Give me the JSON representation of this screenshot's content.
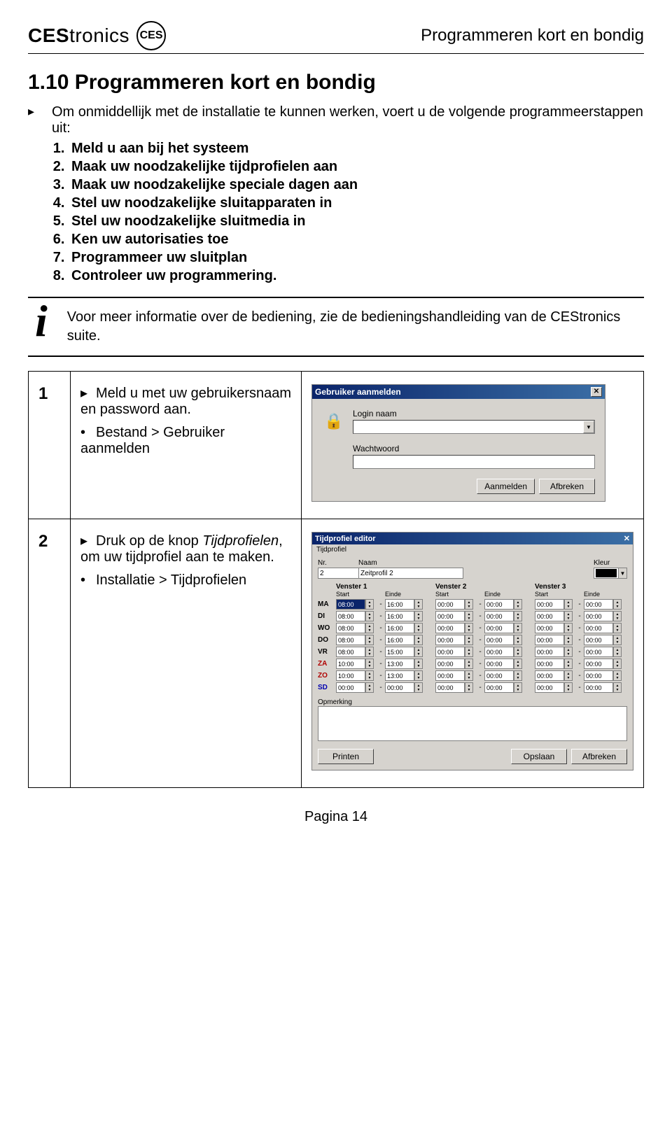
{
  "header": {
    "brand_prefix": "CES",
    "brand_suffix": "tronics",
    "badge": "CES",
    "doc_title": "Programmeren kort en bondig"
  },
  "section": {
    "title": "1.10 Programmeren kort en bondig",
    "intro": "Om onmiddellijk met de installatie te kunnen werken, voert u de volgende programmeerstappen uit:",
    "steps": [
      "Meld u aan bij het systeem",
      "Maak uw noodzakelijke tijdprofielen aan",
      "Maak uw noodzakelijke speciale dagen aan",
      "Stel uw noodzakelijke sluitapparaten in",
      "Stel uw noodzakelijke sluitmedia in",
      "Ken uw autorisaties toe",
      "Programmeer uw sluitplan",
      "Controleer uw programmering."
    ],
    "info": "Voor meer informatie over de bediening, zie de bedieningshandleiding van de CEStronics suite."
  },
  "table": {
    "row1": {
      "num": "1",
      "main": "Meld u met uw gebruikersnaam en password aan.",
      "sub": "Bestand > Gebruiker aanmelden"
    },
    "row2": {
      "num": "2",
      "main_a": "Druk op de knop ",
      "main_em": "Tijdprofielen",
      "main_b": ", om uw tijdprofiel aan te maken.",
      "sub": "Installatie > Tijdprofielen"
    }
  },
  "dlg1": {
    "title": "Gebruiker aanmelden",
    "label_login": "Login naam",
    "label_pass": "Wachtwoord",
    "btn_ok": "Aanmelden",
    "btn_cancel": "Afbreken"
  },
  "dlg2": {
    "title": "Tijdprofiel editor",
    "menu": "Tijdprofiel",
    "lbl_nr": "Nr.",
    "val_nr": "2",
    "lbl_naam": "Naam",
    "val_naam": "Zeitprofil 2",
    "lbl_kleur": "Kleur",
    "venster_labels": [
      "Venster 1",
      "Venster 2",
      "Venster 3"
    ],
    "sub_labels": [
      "Start",
      "Einde"
    ],
    "days": [
      "MA",
      "DI",
      "WO",
      "DO",
      "VR",
      "ZA",
      "ZO",
      "SD"
    ],
    "day_colors": [
      "",
      "",
      "",
      "",
      "",
      "red",
      "red",
      "blue"
    ],
    "times": [
      [
        "08:00",
        "16:00",
        "00:00",
        "00:00",
        "00:00",
        "00:00"
      ],
      [
        "08:00",
        "16:00",
        "00:00",
        "00:00",
        "00:00",
        "00:00"
      ],
      [
        "08:00",
        "16:00",
        "00:00",
        "00:00",
        "00:00",
        "00:00"
      ],
      [
        "08:00",
        "16:00",
        "00:00",
        "00:00",
        "00:00",
        "00:00"
      ],
      [
        "08:00",
        "15:00",
        "00:00",
        "00:00",
        "00:00",
        "00:00"
      ],
      [
        "10:00",
        "13:00",
        "00:00",
        "00:00",
        "00:00",
        "00:00"
      ],
      [
        "10:00",
        "13:00",
        "00:00",
        "00:00",
        "00:00",
        "00:00"
      ],
      [
        "00:00",
        "00:00",
        "00:00",
        "00:00",
        "00:00",
        "00:00"
      ]
    ],
    "selected_cell": [
      0,
      0
    ],
    "lbl_opm": "Opmerking",
    "btn_print": "Printen",
    "btn_save": "Opslaan",
    "btn_cancel": "Afbreken"
  },
  "footer": {
    "page": "Pagina 14"
  }
}
